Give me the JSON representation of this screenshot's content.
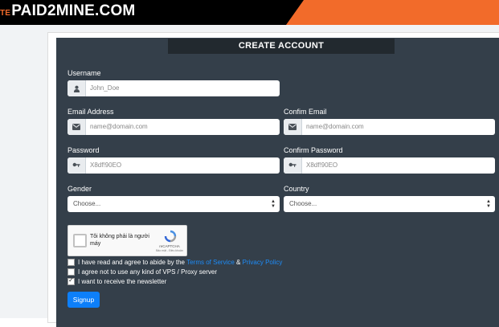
{
  "header": {
    "logo_prefix": "TE",
    "logo": "PAID2MINE.COM"
  },
  "form": {
    "title": "CREATE ACCOUNT",
    "username": {
      "label": "Username",
      "placeholder": "John_Doe"
    },
    "email": {
      "label": "Email Address",
      "placeholder": "name@domain.com"
    },
    "confirm_email": {
      "label": "Confim Email",
      "placeholder": "name@domain.com"
    },
    "password": {
      "label": "Password",
      "placeholder": "X8df!90EO"
    },
    "confirm_password": {
      "label": "Confirm Password",
      "placeholder": "X8df!90EO"
    },
    "gender": {
      "label": "Gender",
      "selected": "Choose..."
    },
    "country": {
      "label": "Country",
      "selected": "Choose..."
    },
    "captcha": {
      "text": "Tôi không phải là người máy",
      "brand": "reCAPTCHA",
      "terms": "Bảo mật - Điều khoản"
    },
    "agree_terms": {
      "prefix": "I have read and agree to abide by the",
      "terms_link": "Terms of Service",
      "amp": "&",
      "privacy_link": "Privacy Policy",
      "checked": false
    },
    "agree_vps": {
      "label": "I agree not to use any kind of VPS / Proxy server",
      "checked": false
    },
    "newsletter": {
      "label": "I want to receive the newsletter",
      "checked": true
    },
    "signup_label": "Signup"
  }
}
